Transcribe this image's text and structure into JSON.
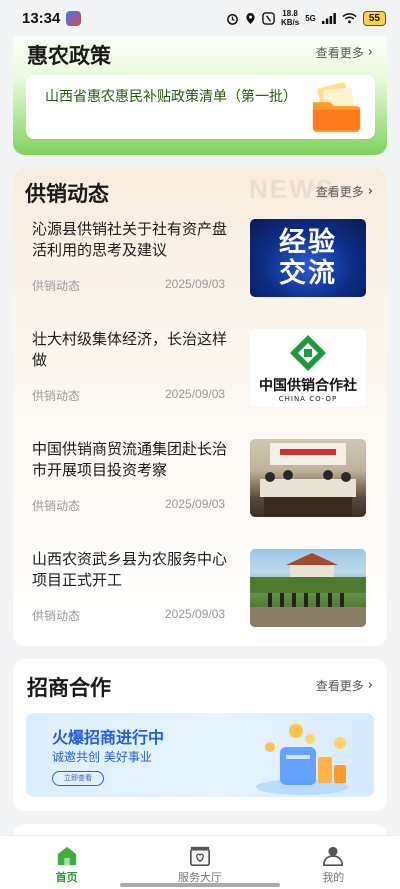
{
  "status_bar": {
    "time": "13:34",
    "net_speed_value": "18.8",
    "net_speed_unit": "KB/s",
    "signal": "5G",
    "battery": "55"
  },
  "policy": {
    "title": "惠农政策",
    "more": "查看更多",
    "item_text": "山西省惠农惠民补贴政策清单（第一批）"
  },
  "news": {
    "title": "供销动态",
    "more": "查看更多",
    "watermark": "NEWS",
    "items": [
      {
        "title": "沁源县供销社关于社有资产盘活利用的思考及建议",
        "category": "供销动态",
        "date": "2025/09/03",
        "thumb_text_1": "经验",
        "thumb_text_2": "交流"
      },
      {
        "title": "壮大村级集体经济，长治这样做",
        "category": "供销动态",
        "date": "2025/09/03",
        "thumb_cn": "中国供销合作社",
        "thumb_en": "CHINA CO-OP"
      },
      {
        "title": "中国供销商贸流通集团赴长治市开展项目投资考察",
        "category": "供销动态",
        "date": "2025/09/03"
      },
      {
        "title": "山西农资武乡县为农服务中心项目正式开工",
        "category": "供销动态",
        "date": "2025/09/03"
      }
    ]
  },
  "invest": {
    "title": "招商合作",
    "more": "查看更多",
    "banner_title": "火爆招商进行中",
    "banner_sub": "诚邀共创 美好事业",
    "banner_button": "立即查看"
  },
  "bottom_nav": [
    {
      "label": "首页",
      "icon": "home-icon",
      "active": true
    },
    {
      "label": "服务大厅",
      "icon": "service-hall-icon",
      "active": false
    },
    {
      "label": "我的",
      "icon": "profile-icon",
      "active": false
    }
  ],
  "colors": {
    "accent_green": "#2f9c2f",
    "policy_gradient_end": "#7fd35a",
    "banner_blue": "#1f5fe0"
  }
}
